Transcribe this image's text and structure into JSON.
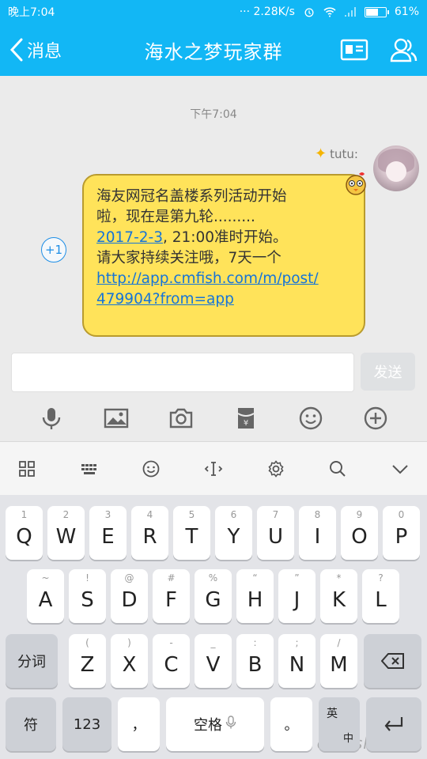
{
  "status_bar": {
    "time": "晚上7:04",
    "speed": "··· 2.28K/s",
    "battery": "61%",
    "battery_level": 0.61
  },
  "header": {
    "back_label": "消息",
    "title": "海水之梦玩家群"
  },
  "chat": {
    "timestamp": "下午7:04",
    "sender_nick": "tutu:",
    "plus_one": "+1",
    "message": {
      "line1": "海友网冠名盖楼系列活动开始",
      "line2": "啦，现在是第九轮.........",
      "date_link": "2017-2-3",
      "line3_rest": ", 21:00准时开始。",
      "line4": "请大家持续关注哦，7天一个",
      "url_line1": "http://app.cmfish.com/m/post/",
      "url_line2": "479904?from=app"
    }
  },
  "input": {
    "value": "",
    "send_label": "发送"
  },
  "toolbar": [
    "mic-icon",
    "image-icon",
    "camera-icon",
    "red-packet-icon",
    "emoji-icon",
    "plus-icon"
  ],
  "keyboard_tools": [
    "grid-icon",
    "keyboard-icon",
    "smiley-icon",
    "cursor-icon",
    "settings-icon",
    "search-icon",
    "collapse-icon"
  ],
  "keyboard": {
    "row1": [
      {
        "hint": "1",
        "key": "Q"
      },
      {
        "hint": "2",
        "key": "W"
      },
      {
        "hint": "3",
        "key": "E"
      },
      {
        "hint": "4",
        "key": "R"
      },
      {
        "hint": "5",
        "key": "T"
      },
      {
        "hint": "6",
        "key": "Y"
      },
      {
        "hint": "7",
        "key": "U"
      },
      {
        "hint": "8",
        "key": "I"
      },
      {
        "hint": "9",
        "key": "O"
      },
      {
        "hint": "0",
        "key": "P"
      }
    ],
    "row2": [
      {
        "hint": "~",
        "key": "A"
      },
      {
        "hint": "!",
        "key": "S"
      },
      {
        "hint": "@",
        "key": "D"
      },
      {
        "hint": "#",
        "key": "F"
      },
      {
        "hint": "%",
        "key": "G"
      },
      {
        "hint": "“",
        "key": "H"
      },
      {
        "hint": "”",
        "key": "J"
      },
      {
        "hint": "*",
        "key": "K"
      },
      {
        "hint": "?",
        "key": "L"
      }
    ],
    "row3": [
      {
        "hint": "(",
        "key": "Z"
      },
      {
        "hint": ")",
        "key": "X"
      },
      {
        "hint": "-",
        "key": "C"
      },
      {
        "hint": "_",
        "key": "V"
      },
      {
        "hint": ":",
        "key": "B"
      },
      {
        "hint": ";",
        "key": "N"
      },
      {
        "hint": "/",
        "key": "M"
      }
    ],
    "fenci": "分词",
    "symbol": "符",
    "num": "123",
    "comma": "，",
    "space": "空格",
    "period": "。",
    "lang_top": "英",
    "lang_bottom": "中"
  },
  "watermark": "cmfish.com"
}
